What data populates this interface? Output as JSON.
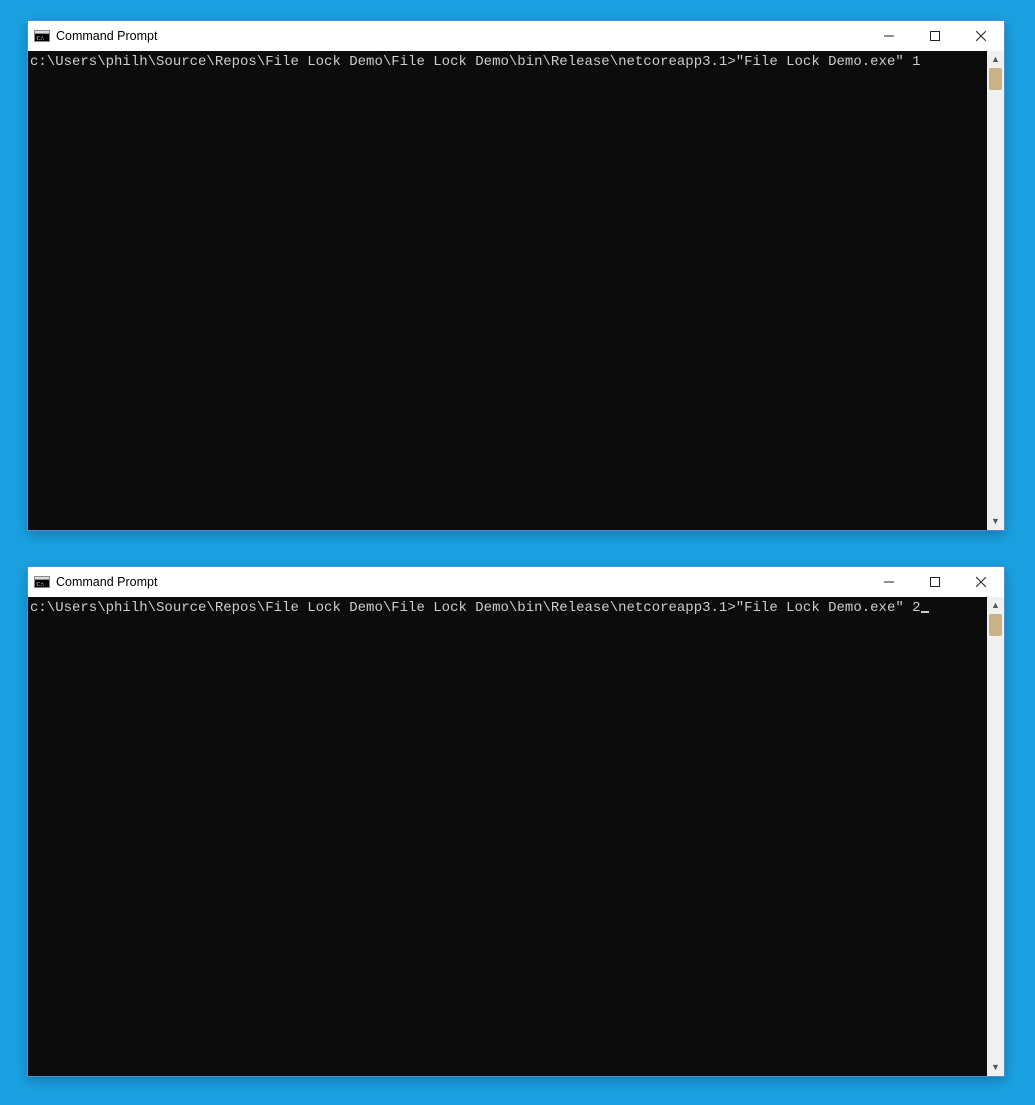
{
  "windows": [
    {
      "title": "Command Prompt",
      "prompt": "c:\\Users\\philh\\Source\\Repos\\File Lock Demo\\File Lock Demo\\bin\\Release\\netcoreapp3.1>",
      "command": "\"File Lock Demo.exe\" 1",
      "show_cursor": false
    },
    {
      "title": "Command Prompt",
      "prompt": "c:\\Users\\philh\\Source\\Repos\\File Lock Demo\\File Lock Demo\\bin\\Release\\netcoreapp3.1>",
      "command": "\"File Lock Demo.exe\" 2",
      "show_cursor": true
    }
  ]
}
